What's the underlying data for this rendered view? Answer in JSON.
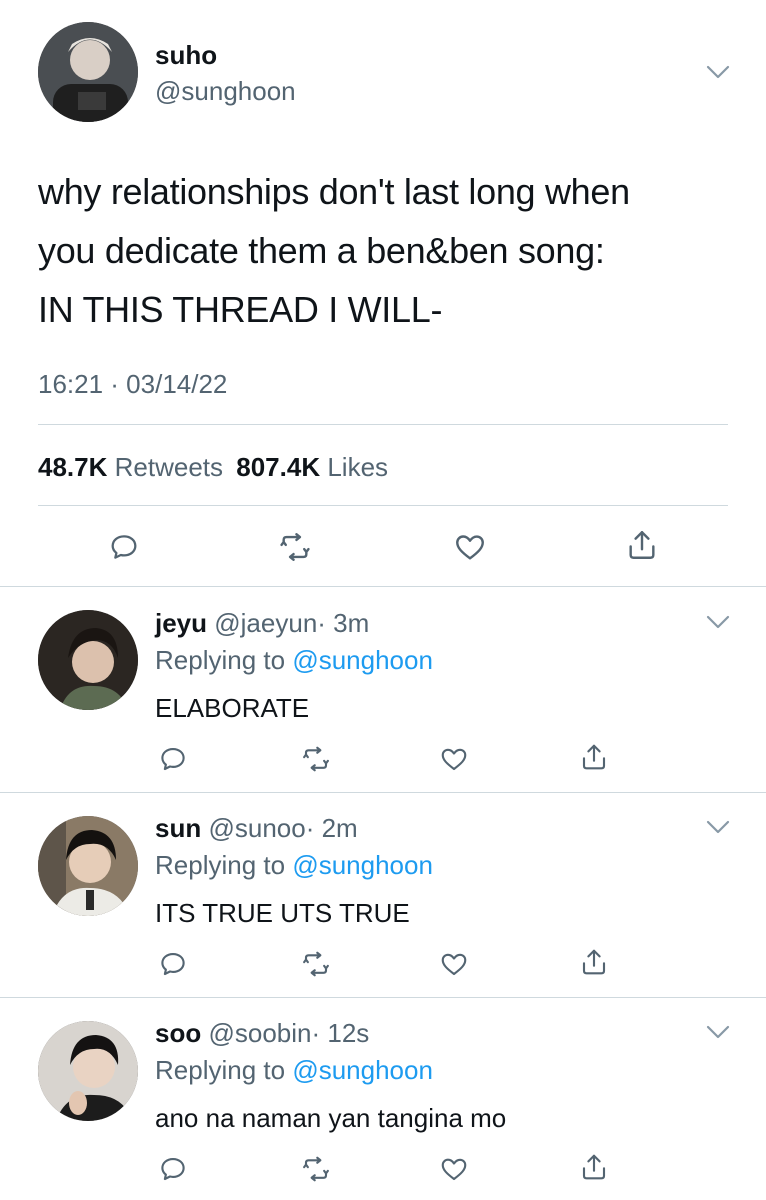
{
  "main_tweet": {
    "display_name": "suho",
    "handle": "@sunghoon",
    "text_lines": [
      "why relationships don't last long when",
      "you dedicate them a ben&ben song:",
      "IN THIS THREAD I WILL-"
    ],
    "timestamp": "16:21 · 03/14/22",
    "retweets_count": "48.7K",
    "retweets_label": "Retweets",
    "likes_count": "807.4K",
    "likes_label": "Likes"
  },
  "replies": [
    {
      "display_name": "jeyu",
      "handle": "@jaeyun",
      "time": "· 3m",
      "replying_prefix": "Replying to",
      "replying_handle": "@sunghoon",
      "text": "ELABORATE"
    },
    {
      "display_name": "sun",
      "handle": "@sunoo",
      "time": "· 2m",
      "replying_prefix": "Replying to",
      "replying_handle": "@sunghoon",
      "text": "ITS TRUE UTS TRUE"
    },
    {
      "display_name": "soo",
      "handle": "@soobin",
      "time": "· 12s",
      "replying_prefix": "Replying to",
      "replying_handle": "@sunghoon",
      "text": "ano na naman yan tangina mo"
    }
  ],
  "icons": [
    "reply-icon",
    "retweet-icon",
    "like-icon",
    "share-icon",
    "chevron-down-icon"
  ],
  "colors": {
    "text": "#0f1419",
    "secondary": "#536471",
    "link": "#1d9bf0",
    "divider": "#cfd9de"
  }
}
